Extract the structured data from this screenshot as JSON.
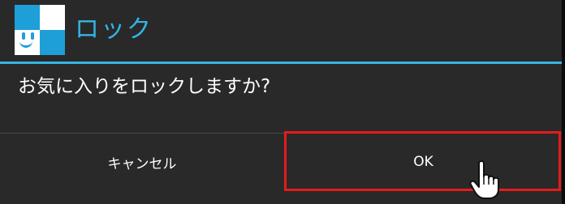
{
  "dialog": {
    "title": "ロック",
    "message": "お気に入りをロックしますか?",
    "buttons": {
      "cancel_label": "キャンセル",
      "ok_label": "OK"
    },
    "app_icon": "lock-app-icon",
    "cursor_icon": "pointing-hand-icon",
    "accent_color": "#33b5e5",
    "highlight_color": "#e51b1b"
  }
}
